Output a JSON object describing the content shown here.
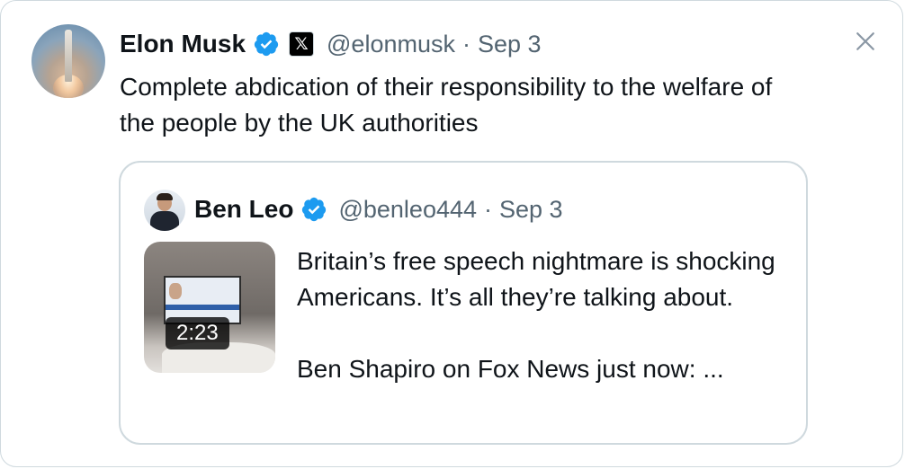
{
  "tweet": {
    "author_name": "Elon Musk",
    "handle": "@elonmusk",
    "separator": "·",
    "date": "Sep 3",
    "text": "Complete abdication of their responsibility to the welfare of the people by the UK authorities",
    "x_badge": "𝕏"
  },
  "quoted_tweet": {
    "author_name": "Ben Leo",
    "handle": "@benleo444",
    "separator": "·",
    "date": "Sep 3",
    "text_line1": "Britain’s free speech nightmare is shocking Americans. It’s all they’re talking about.",
    "text_line2": "Ben Shapiro on Fox News just now: ...",
    "media_duration": "2:23"
  },
  "colors": {
    "verified": "#1d9bf0",
    "secondary_text": "#536471",
    "border": "#cfd9de"
  },
  "icons": [
    "verified-badge-icon",
    "x-affiliate-badge-icon",
    "close-icon",
    "video-thumbnail"
  ]
}
